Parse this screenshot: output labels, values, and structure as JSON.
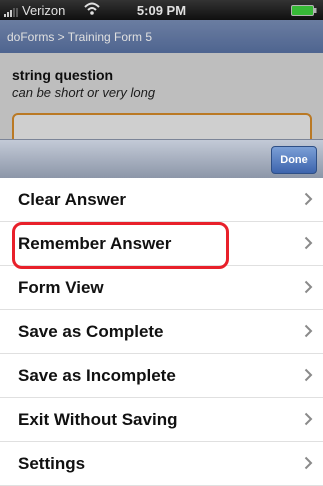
{
  "status_bar": {
    "carrier": "Verizon",
    "time": "5:09 PM",
    "icons": [
      "signal-icon",
      "wifi-icon",
      "battery-icon"
    ]
  },
  "nav": {
    "breadcrumb": "doForms > Training Form 5"
  },
  "form": {
    "question_title": "string question",
    "question_hint": "can be short or very long",
    "answer_value": ""
  },
  "toolbar": {
    "done_label": "Done"
  },
  "menu": {
    "items": [
      {
        "label": "Clear Answer"
      },
      {
        "label": "Remember Answer"
      },
      {
        "label": "Form View"
      },
      {
        "label": "Save as Complete"
      },
      {
        "label": "Save as Incomplete"
      },
      {
        "label": "Exit Without Saving"
      },
      {
        "label": "Settings"
      }
    ],
    "highlighted_item": "Remember Answer",
    "chevron_icon": "chevron-right-icon"
  },
  "colors": {
    "highlight": "#e8202a",
    "nav_blue": "#5a73a4",
    "done_button": "#3d64ad",
    "answer_border": "#d48a2a"
  }
}
